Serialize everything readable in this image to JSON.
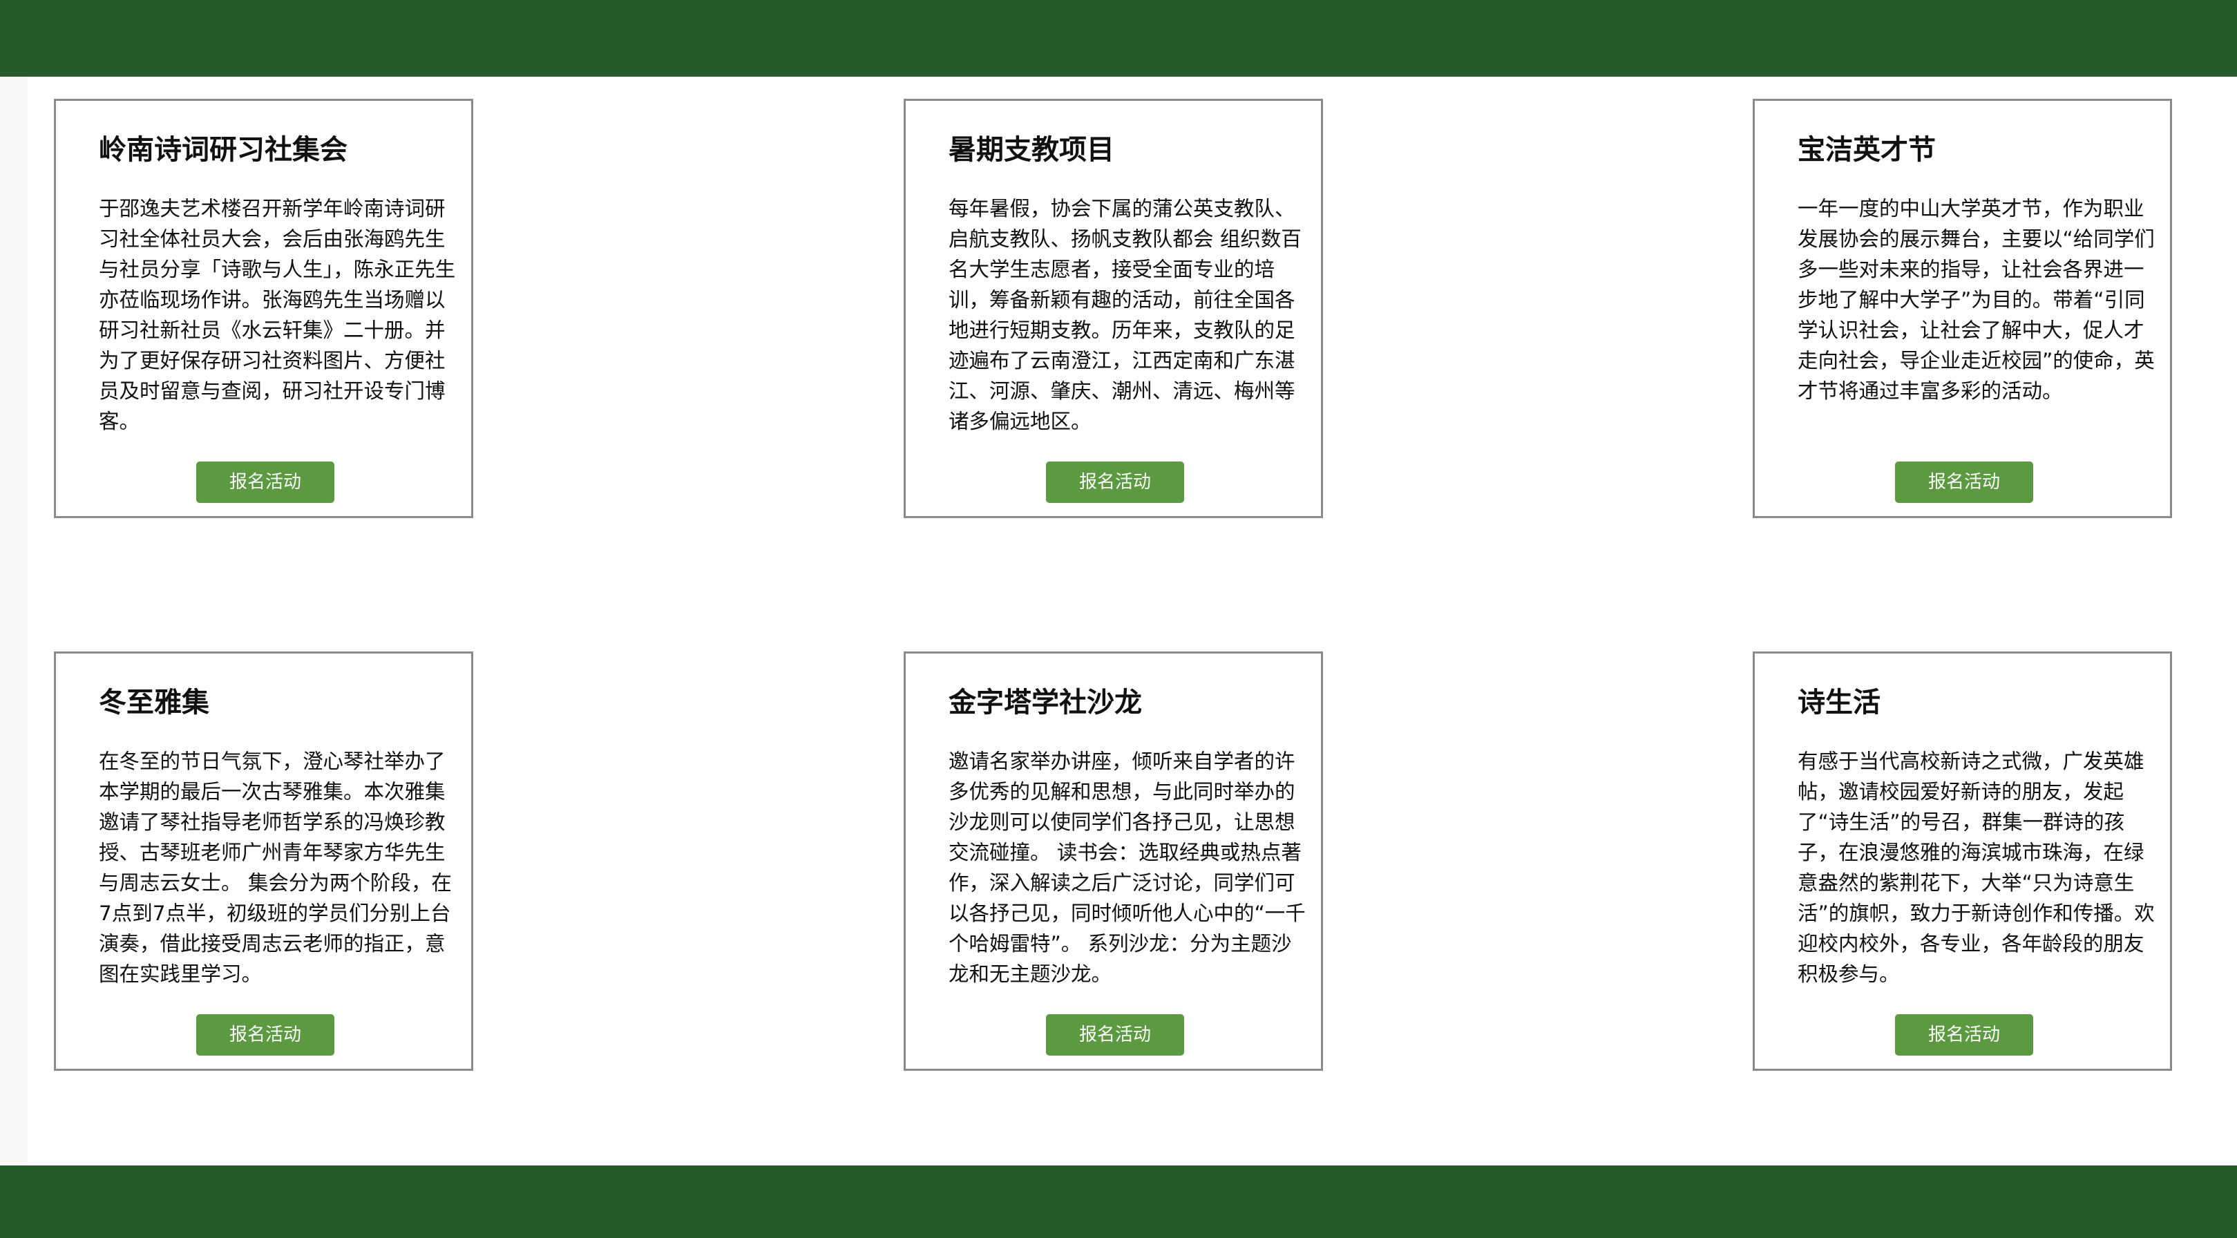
{
  "colors": {
    "header_bar": "#245a2c",
    "footer_bar": "#245a2c",
    "button": "#5c9a42",
    "card_border": "#8a8a8a"
  },
  "activities": [
    {
      "title": "岭南诗词研习社集会",
      "description": "于邵逸夫艺术楼召开新学年岭南诗词研习社全体社员大会，会后由张海鸥先生与社员分享「诗歌与人生」，陈永正先生亦莅临现场作讲。张海鸥先生当场赠以研习社新社员《水云轩集》二十册。并为了更好保存研习社资料图片、方便社员及时留意与查阅，研习社开设专门博客。",
      "button_label": "报名活动"
    },
    {
      "title": "暑期支教项目",
      "description": "每年暑假，协会下属的蒲公英支教队、启航支教队、扬帆支教队都会 组织数百名大学生志愿者，接受全面专业的培训，筹备新颖有趣的活动，前往全国各地进行短期支教。历年来，支教队的足迹遍布了云南澄江，江西定南和广东湛江、河源、肇庆、潮州、清远、梅州等诸多偏远地区。",
      "button_label": "报名活动"
    },
    {
      "title": "宝洁英才节",
      "description": "一年一度的中山大学英才节，作为职业发展协会的展示舞台，主要以“给同学们多一些对未来的指导，让社会各界进一步地了解中大学子”为目的。带着“引同学认识社会，让社会了解中大，促人才走向社会，导企业走近校园”的使命，英才节将通过丰富多彩的活动。",
      "button_label": "报名活动"
    },
    {
      "title": "冬至雅集",
      "description": "在冬至的节日气氛下，澄心琴社举办了本学期的最后一次古琴雅集。本次雅集邀请了琴社指导老师哲学系的冯焕珍教授、古琴班老师广州青年琴家方华先生与周志云女士。 集会分为两个阶段，在7点到7点半，初级班的学员们分别上台演奏，借此接受周志云老师的指正，意图在实践里学习。",
      "button_label": "报名活动"
    },
    {
      "title": "金字塔学社沙龙",
      "description": "邀请名家举办讲座，倾听来自学者的许多优秀的见解和思想，与此同时举办的沙龙则可以使同学们各抒己见，让思想交流碰撞。 读书会：选取经典或热点著作，深入解读之后广泛讨论，同学们可以各抒己见，同时倾听他人心中的“一千个哈姆雷特”。 系列沙龙：分为主题沙龙和无主题沙龙。",
      "button_label": "报名活动"
    },
    {
      "title": "诗生活",
      "description": "有感于当代高校新诗之式微，广发英雄帖，邀请校园爱好新诗的朋友，发起了“诗生活”的号召，群集一群诗的孩子，在浪漫悠雅的海滨城市珠海，在绿意盎然的紫荆花下，大举“只为诗意生活”的旗帜，致力于新诗创作和传播。欢迎校内校外，各专业，各年龄段的朋友积极参与。",
      "button_label": "报名活动"
    }
  ]
}
